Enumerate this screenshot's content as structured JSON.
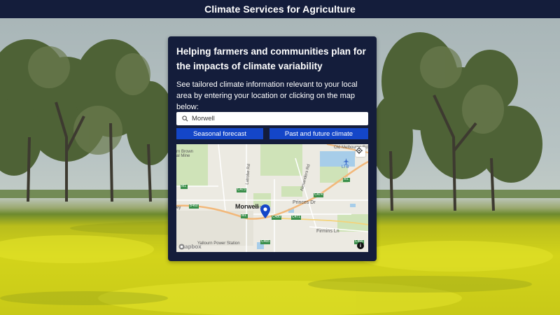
{
  "header": {
    "title": "Climate Services for Agriculture"
  },
  "card": {
    "heading": "Helping farmers and communities plan for the impacts of climate variability",
    "description": "See tailored climate information relevant to your local area by entering your location or clicking on the map below:",
    "search": {
      "value": "Morwell",
      "placeholder": ""
    },
    "buttons": {
      "seasonal": "Seasonal forecast",
      "past_future": "Past and future climate"
    }
  },
  "map": {
    "town": "Morwell",
    "labels": {
      "old_melbourne_rd": "Old Melbourne Rd",
      "brown_mine": "rn Brown\nal Mine",
      "airport": "LTB",
      "latrobe_rd": "Latrobe Rd",
      "alexanders_rd": "Alexanders Rd",
      "princes_dr": "Princes Dr",
      "firmins_ln": "Firmins Ln",
      "yallourn": "Yallourn Power Station",
      "ey": "ey",
      "m1_a": "M1",
      "m1_b": "M1",
      "m1_c": "M1",
      "b460": "B460",
      "c473": "C473",
      "c474": "C474",
      "c471": "C471",
      "c480": "C480",
      "c466": "C466",
      "c465": "C465",
      "c472": "C472"
    },
    "attribution": "mapbox",
    "info": "i"
  },
  "icons": {
    "search": "search-icon",
    "locate": "crosshair-icon",
    "pin": "map-pin-icon",
    "plane": "airplane-icon",
    "info": "info-icon",
    "mapbox": "mapbox-logo-icon"
  },
  "colors": {
    "header_bg": "#141d3b",
    "card_bg": "#141d3b",
    "button_bg": "#1446c8",
    "pin": "#1446c8"
  }
}
